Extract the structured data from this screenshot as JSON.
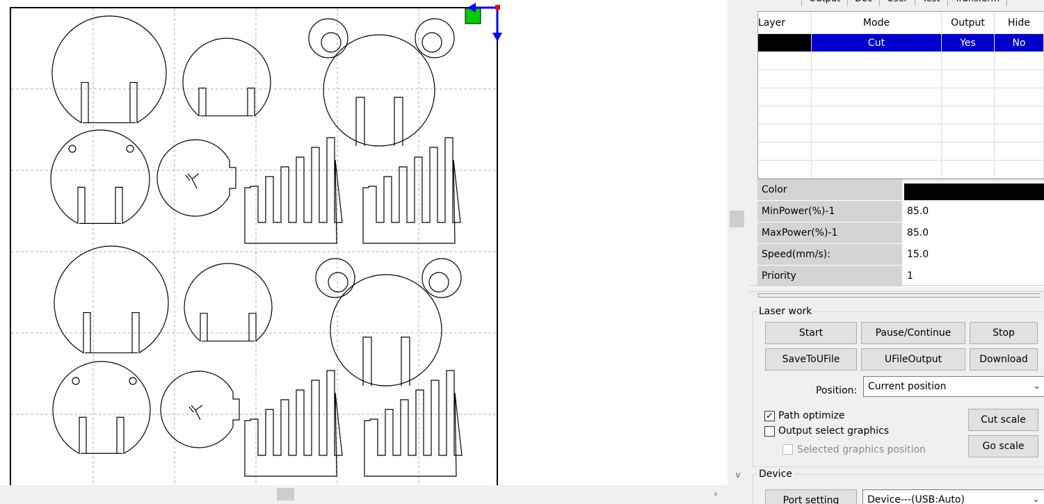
{
  "canvas": {
    "right_arrow": "›",
    "up_arrow": "^",
    "down_arrow": "v"
  },
  "tabs": [
    "Output",
    "Doc",
    "User",
    "Test",
    "Transform"
  ],
  "layer_table": {
    "headers": [
      "Layer",
      "Mode",
      "Output",
      "Hide"
    ],
    "rows": [
      {
        "mode": "Cut",
        "output": "Yes",
        "hide": "No",
        "color": "#000000"
      }
    ]
  },
  "properties": {
    "color_label": "Color",
    "color_value": "#000000",
    "min_power_label": "MinPower(%)-1",
    "min_power": "85.0",
    "max_power_label": "MaxPower(%)-1",
    "max_power": "85.0",
    "speed_label": "Speed(mm/s):",
    "speed": "15.0",
    "priority_label": "Priority",
    "priority": "1"
  },
  "laser_work": {
    "title": "Laser work",
    "start": "Start",
    "pause_continue": "Pause/Continue",
    "stop": "Stop",
    "save_to_ufile": "SaveToUFile",
    "ufile_output": "UFileOutput",
    "download": "Download",
    "position_label": "Position:",
    "position_value": "Current position",
    "path_optimize": "Path optimize",
    "path_optimize_checked": true,
    "output_select_graphics": "Output select graphics",
    "output_select_checked": false,
    "selected_graphics_position": "Selected graphics position",
    "cut_scale": "Cut scale",
    "go_scale": "Go scale"
  },
  "device": {
    "title": "Device",
    "port_setting": "Port setting",
    "device_value": "Device---(USB:Auto)"
  },
  "colors": {
    "selection": "#0000ce",
    "origin_marker": "#00cc00",
    "axis": "#0000ff",
    "origin_point": "#ff0000"
  }
}
